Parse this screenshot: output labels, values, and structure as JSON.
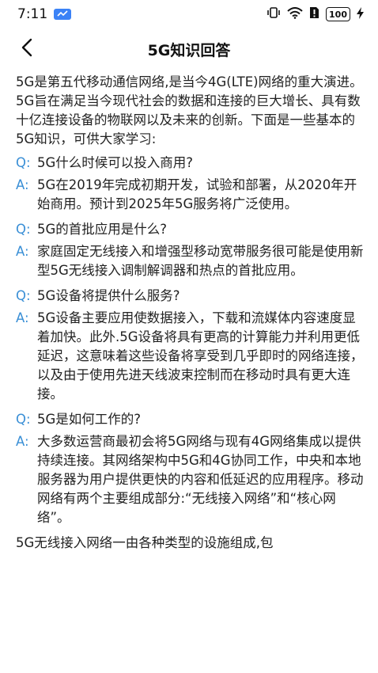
{
  "status_bar": {
    "time": "7:11",
    "battery": "100",
    "icons": [
      "app-notification-icon",
      "vibrate-icon",
      "wifi-icon",
      "sim-alert-icon",
      "battery-icon",
      "charging-icon"
    ]
  },
  "header": {
    "title": "5G知识回答",
    "back_icon": "back-chevron-icon"
  },
  "content": {
    "intro": "5G是第五代移动通信网络,是当今4G(LTE)网络的重大演进。5G旨在满足当今现代社会的数据和连接的巨大增长、具有数十亿连接设备的物联网以及未来的创新。下面是一些基本的5G知识，可供大家学习:",
    "q_label": "Q:",
    "a_label": "A:",
    "qa": [
      {
        "q": "5G什么时候可以投入商用?",
        "a": "5G在2019年完成初期开发，试验和部署，从2020年开始商用。预计到2025年5G服务将广泛使用。"
      },
      {
        "q": "5G的首批应用是什么?",
        "a": "家庭固定无线接入和增强型移动宽带服务很可能是使用新型5G无线接入调制解调器和热点的首批应用。"
      },
      {
        "q": "5G设备将提供什么服务?",
        "a": "5G设备主要应用使数据接入，下载和流媒体内容速度显着加快。此外.5G设备将具有更高的计算能力并利用更低延迟，这意味着这些设备将享受到几乎即时的网络连接，以及由于使用先进天线波束控制而在移动时具有更大连接。"
      },
      {
        "q": "5G是如何工作的?",
        "a": "大多数运营商最初会将5G网络与现有4G网络集成以提供持续连接。其网络架构中5G和4G协同工作，中央和本地服务器为用户提供更快的内容和低延迟的应用程序。移动网络有两个主要组成部分:“无线接入网络”和“核心网络”。"
      }
    ],
    "tail": "5G无线接入网络一由各种类型的设施组成,包"
  }
}
